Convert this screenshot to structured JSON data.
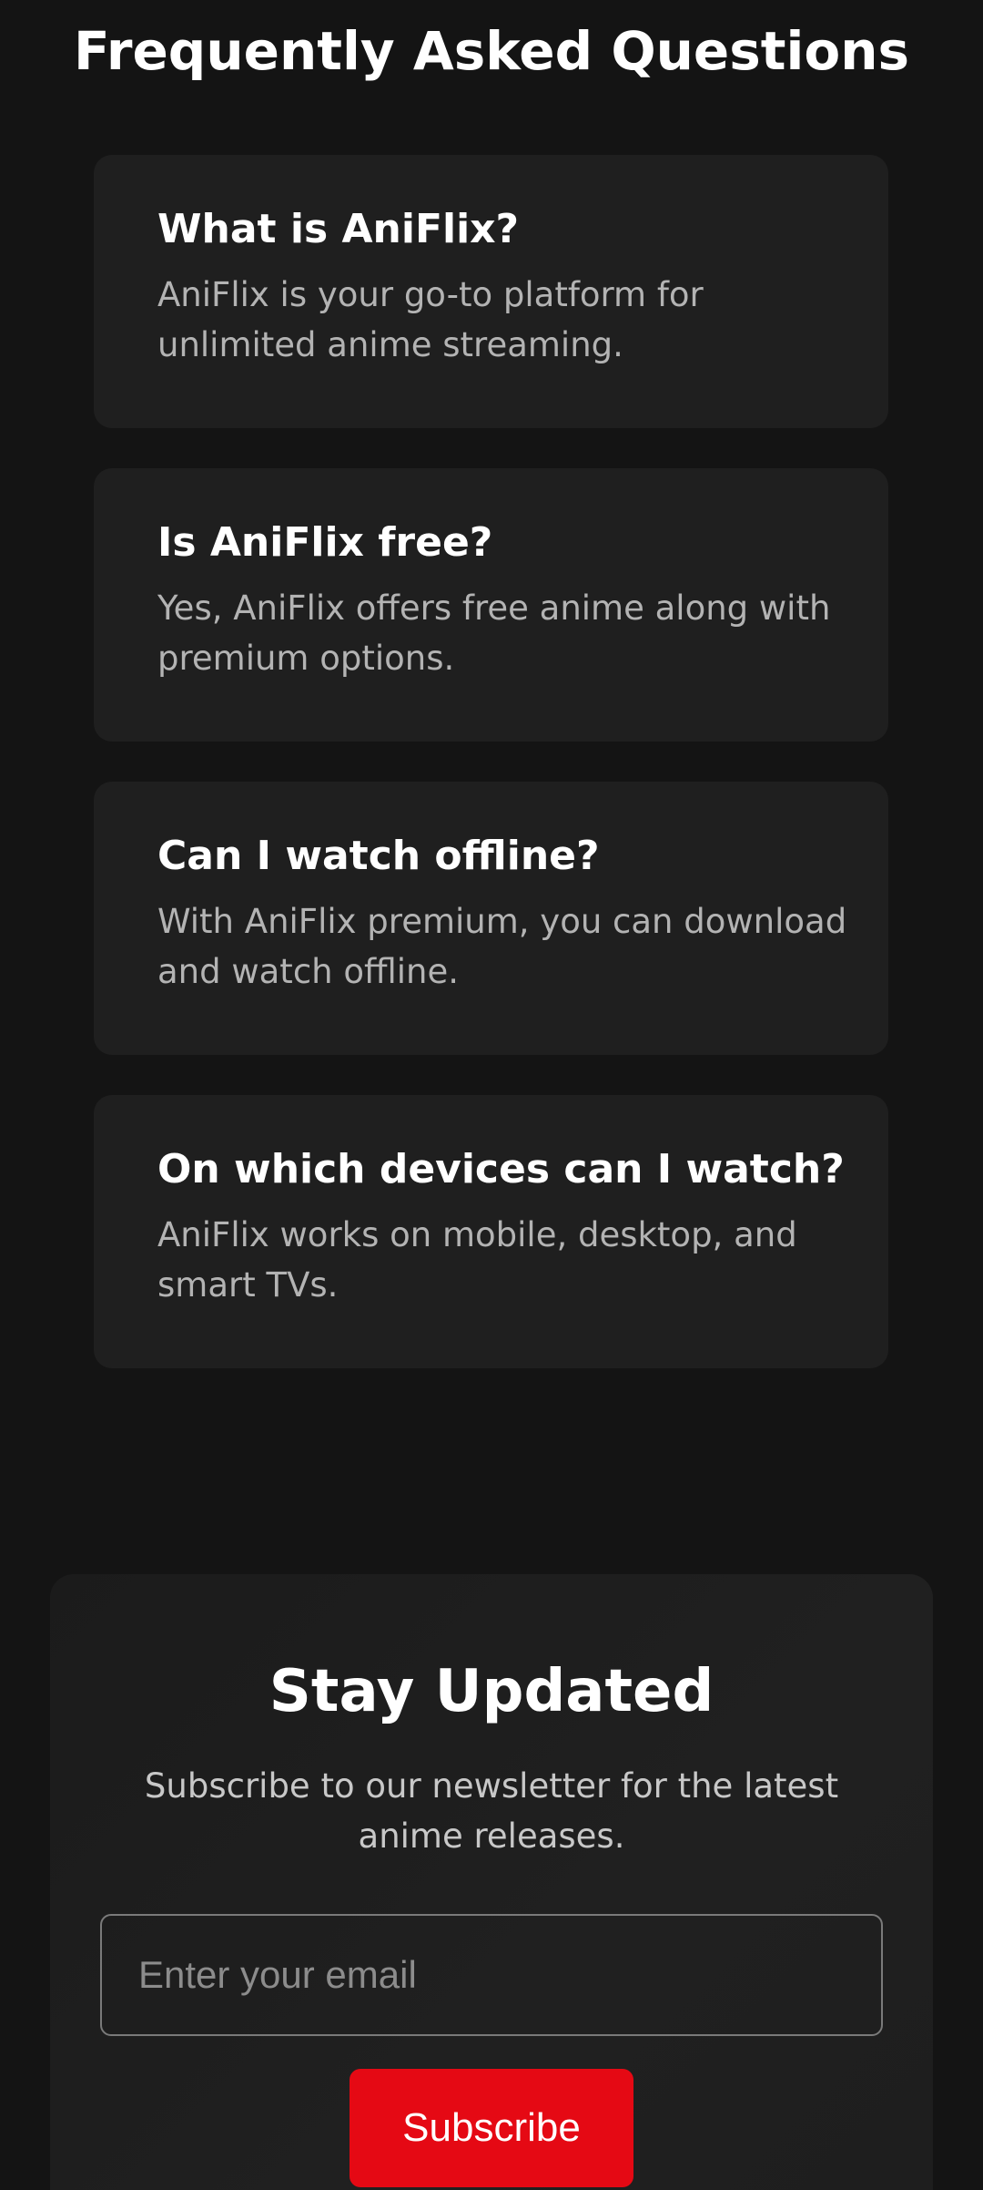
{
  "faq": {
    "title": "Frequently Asked Questions",
    "items": [
      {
        "question": "What is AniFlix?",
        "answer": "AniFlix is your go-to platform for unlimited anime streaming."
      },
      {
        "question": "Is AniFlix free?",
        "answer": "Yes, AniFlix offers free anime along with premium options."
      },
      {
        "question": "Can I watch offline?",
        "answer": "With AniFlix premium, you can download and watch offline."
      },
      {
        "question": "On which devices can I watch?",
        "answer": "AniFlix works on mobile, desktop, and smart TVs."
      }
    ]
  },
  "newsletter": {
    "title": "Stay Updated",
    "description": "Subscribe to our newsletter for the latest anime releases.",
    "email_placeholder": "Enter your email",
    "email_value": "",
    "subscribe_label": "Subscribe"
  },
  "colors": {
    "background": "#141414",
    "card": "#1f1f1f",
    "accent": "#e50914",
    "answer_text": "#b3b3b3"
  }
}
